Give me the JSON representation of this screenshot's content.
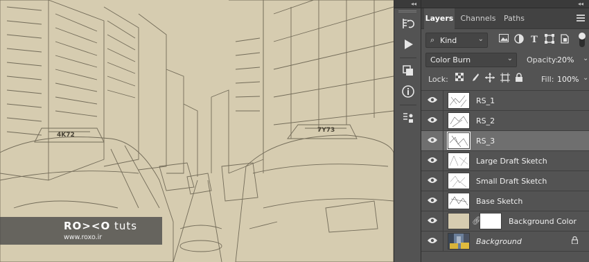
{
  "canvas": {
    "watermark_title_bold": "RO><O",
    "watermark_title_light": " tuts",
    "watermark_url": "www.roxo.ir",
    "taxi_plate_left": "4K72",
    "taxi_plate_right": "7Y73",
    "background_color": "#d6ccb0"
  },
  "panel": {
    "collapse_glyph": "◂◂",
    "tabs": [
      "Layers",
      "Channels",
      "Paths"
    ],
    "active_tab": "Layers",
    "filter": {
      "kind_label": "Kind",
      "icons": [
        "image-filter-icon",
        "adjustment-filter-icon",
        "type-filter-icon",
        "shape-filter-icon",
        "smart-object-filter-icon"
      ]
    },
    "blend_mode": "Color Burn",
    "opacity_label": "Opacity:",
    "opacity_value": "20%",
    "lock_label": "Lock:",
    "fill_label": "Fill:",
    "fill_value": "100%",
    "layers": [
      {
        "name": "RS_1",
        "selected": false
      },
      {
        "name": "RS_2",
        "selected": false
      },
      {
        "name": "RS_3",
        "selected": true
      },
      {
        "name": "Large Draft Sketch",
        "selected": false
      },
      {
        "name": "Small Draft Sketch",
        "selected": false
      },
      {
        "name": "Base Sketch",
        "selected": false
      },
      {
        "name": "Background Color",
        "selected": false
      },
      {
        "name": "Background",
        "selected": false,
        "locked": true
      }
    ]
  },
  "toolstrip": {
    "collapse_glyph": "◂◂",
    "tools": [
      "history-icon",
      "play-action-icon",
      "layer-comps-icon",
      "info-icon",
      "clone-source-icon"
    ]
  }
}
